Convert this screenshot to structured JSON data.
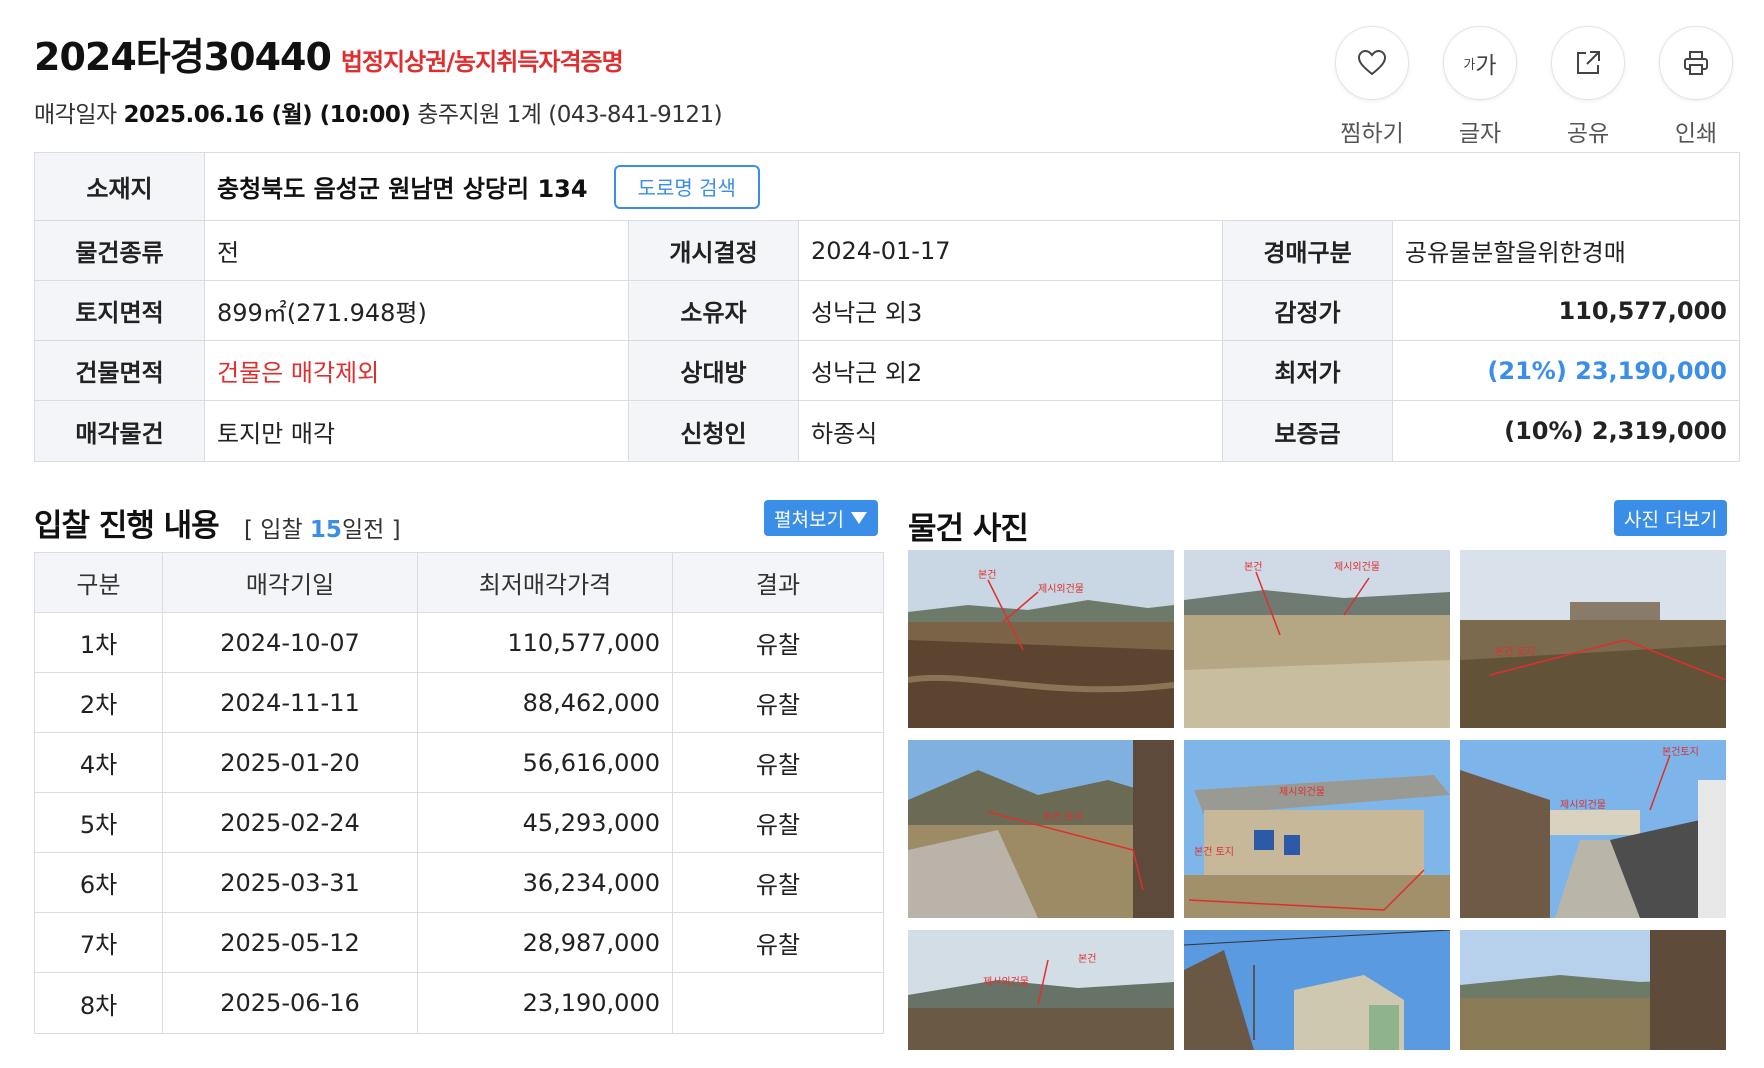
{
  "header": {
    "case_no": "2024타경30440",
    "case_tag": "법정지상권/농지취득자격증명",
    "sale_prefix": "매각일자",
    "sale_datetime": "2025.06.16 (월) (10:00)",
    "sale_court": "충주지원 1계 (043-841-9121)"
  },
  "tools": [
    {
      "label": "찜하기",
      "icon": "heart-icon"
    },
    {
      "label": "글자",
      "icon": "font-size-icon",
      "glyph_small": "가",
      "glyph_big": "가"
    },
    {
      "label": "공유",
      "icon": "share-icon"
    },
    {
      "label": "인쇄",
      "icon": "print-icon"
    }
  ],
  "info": {
    "location_label": "소재지",
    "location_value": "충청북도 음성군 원남면 상당리 134",
    "road_search": "도로명 검색",
    "rows": [
      {
        "l1": "물건종류",
        "v1": "전",
        "l2": "개시결정",
        "v2": "2024-01-17",
        "l3": "경매구분",
        "v3": "공유물분할을위한경매"
      },
      {
        "l1": "토지면적",
        "v1": "899㎡(271.948평)",
        "l2": "소유자",
        "v2": "성낙근 외3",
        "l3": "감정가",
        "v3": "110,577,000"
      },
      {
        "l1": "건물면적",
        "v1": "건물은 매각제외",
        "l2": "상대방",
        "v2": "성낙근 외2",
        "l3": "최저가",
        "v3": "(21%) 23,190,000"
      },
      {
        "l1": "매각물건",
        "v1": "토지만 매각",
        "l2": "신청인",
        "v2": "하종식",
        "l3": "보증금",
        "v3": "(10%) 2,319,000"
      }
    ]
  },
  "bid": {
    "title": "입찰 진행 내용",
    "sub_prefix": "[ 입찰 ",
    "sub_days": "15",
    "sub_suffix": "일전 ]",
    "expand_label": "펼쳐보기",
    "headers": [
      "구분",
      "매각기일",
      "최저매각가격",
      "결과"
    ],
    "rows": [
      {
        "round": "1차",
        "date": "2024-10-07",
        "price": "110,577,000",
        "result": "유찰"
      },
      {
        "round": "2차",
        "date": "2024-11-11",
        "price": "88,462,000",
        "result": "유찰"
      },
      {
        "round": "4차",
        "date": "2025-01-20",
        "price": "56,616,000",
        "result": "유찰"
      },
      {
        "round": "5차",
        "date": "2025-02-24",
        "price": "45,293,000",
        "result": "유찰"
      },
      {
        "round": "6차",
        "date": "2025-03-31",
        "price": "36,234,000",
        "result": "유찰"
      },
      {
        "round": "7차",
        "date": "2025-05-12",
        "price": "28,987,000",
        "result": "유찰"
      },
      {
        "round": "8차",
        "date": "2025-06-16",
        "price": "23,190,000",
        "result": ""
      }
    ]
  },
  "photos": {
    "title": "물건 사진",
    "more_label": "사진 더보기",
    "captions": [
      "본건",
      "제시외건물",
      "본건 토지",
      "본건토지"
    ]
  },
  "colors": {
    "accent_blue": "#3b8ee8",
    "alert_red": "#e02e2e",
    "label_bg": "#f3f5f8",
    "border": "#d9dde3"
  }
}
